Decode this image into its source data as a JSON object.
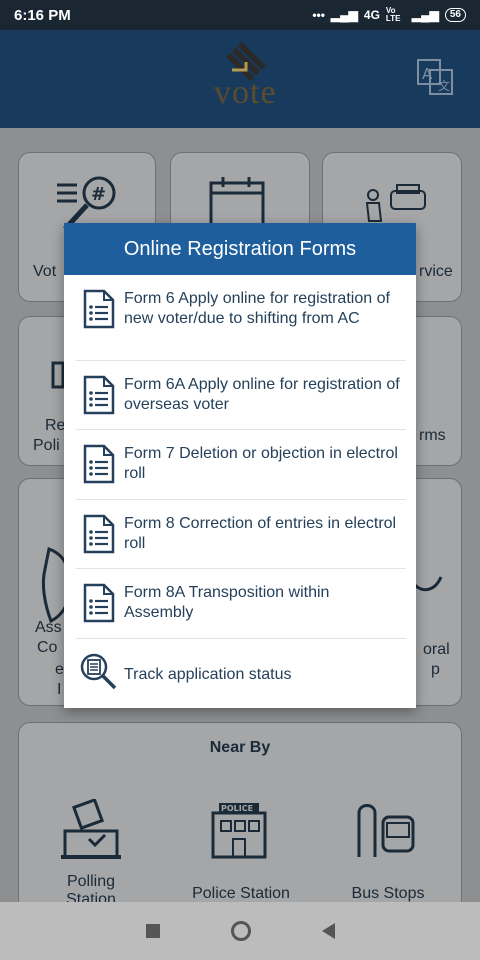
{
  "status_bar": {
    "time": "6:16 PM",
    "network": "4G",
    "volte": "Vo LTE",
    "battery": "56"
  },
  "app": {
    "logo_text": "vote"
  },
  "tiles": {
    "voter_label": "Vot",
    "service_label": "rvice",
    "register_label_1": "Re",
    "register_label_2": "Poli",
    "forms_label": "rms",
    "assembly_1": "Ass",
    "assembly_2": "Co",
    "assembly_3": "e",
    "assembly_4": "I",
    "electoral_1": "oral",
    "electoral_2": "p"
  },
  "nearby": {
    "title": "Near By",
    "items": [
      {
        "label": "Polling Station"
      },
      {
        "label": "Police Station"
      },
      {
        "label": "Bus Stops"
      }
    ],
    "police_sign": "POLICE"
  },
  "dialog": {
    "title": "Online Registration Forms",
    "items": [
      {
        "text": "Form 6 Apply online for registration of new voter/due to shifting from AC"
      },
      {
        "text": "Form 6A Apply online for registration of overseas voter"
      },
      {
        "text": "Form 7 Deletion or objection in electrol roll"
      },
      {
        "text": "Form 8 Correction of entries in electrol roll"
      },
      {
        "text": "Form 8A Transposition within Assembly"
      },
      {
        "text": "Track application status"
      }
    ]
  },
  "colors": {
    "header": "#183a5c",
    "dialog_title": "#1f5e9c",
    "text": "#25405a"
  }
}
